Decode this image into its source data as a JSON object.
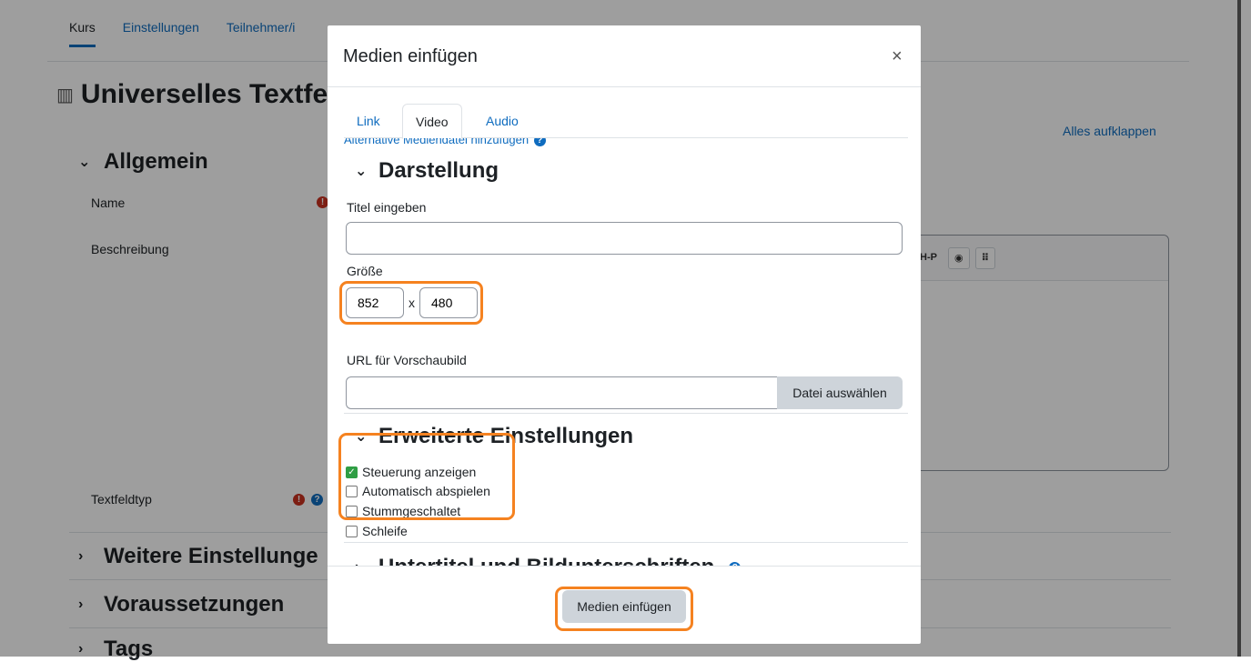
{
  "background": {
    "tabs": [
      "Kurs",
      "Einstellungen",
      "Teilnehmer/i"
    ],
    "title": "Universelles Textfe",
    "expand_all": "Alles aufklappen",
    "general_section": "Allgemein",
    "name_label": "Name",
    "description_label": "Beschreibung",
    "textfield_type_label": "Textfeldtyp",
    "more_settings": "Weitere Einstellunge",
    "prerequisites": "Voraussetzungen",
    "tags": "Tags",
    "toolbar_hp": "H-P"
  },
  "modal": {
    "title": "Medien einfügen",
    "close_glyph": "×",
    "tabs": [
      "Link",
      "Video",
      "Audio"
    ],
    "active_tab": "Video",
    "alt_media_link": "Alternative Mediendatei hinzufügen",
    "display_section": "Darstellung",
    "title_label": "Titel eingeben",
    "title_value": "",
    "size_label": "Größe",
    "width_value": "852",
    "size_separator": "x",
    "height_value": "480",
    "thumbnail_label": "URL für Vorschaubild",
    "thumbnail_value": "",
    "choose_file_button": "Datei auswählen",
    "advanced_section": "Erweiterte Einstellungen",
    "options": [
      {
        "label": "Steuerung anzeigen",
        "checked": true
      },
      {
        "label": "Automatisch abspielen",
        "checked": false
      },
      {
        "label": "Stummgeschaltet",
        "checked": false
      },
      {
        "label": "Schleife",
        "checked": false
      }
    ],
    "subtitles_section": "Untertitel und Bildunterschriften",
    "submit_button": "Medien einfügen"
  },
  "colors": {
    "highlight": "#f58220",
    "link": "#0f6cbf",
    "checked": "#2f9e44"
  }
}
